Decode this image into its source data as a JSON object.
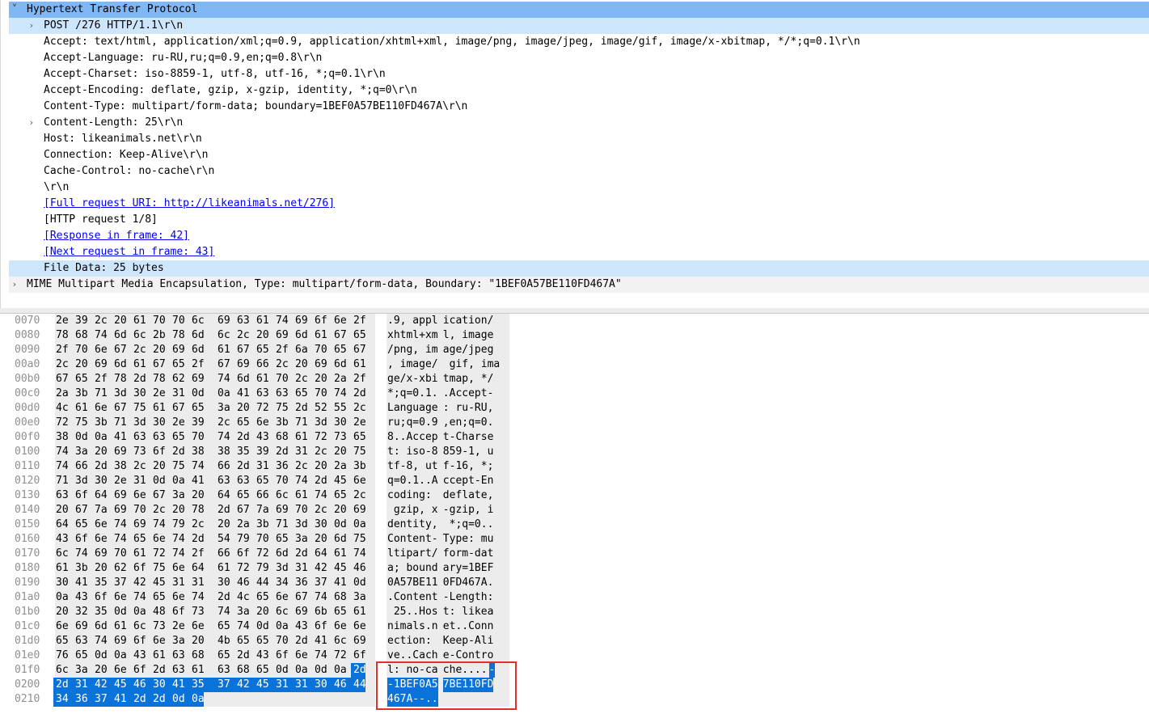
{
  "tree": {
    "rows": [
      {
        "level": 0,
        "toggle": "expanded",
        "text": "Hypertext Transfer Protocol",
        "style": "sel-dark",
        "link": false
      },
      {
        "level": 1,
        "toggle": "collapsed",
        "text": "POST /276 HTTP/1.1\\r\\n",
        "style": "sel-light",
        "link": false
      },
      {
        "level": 1,
        "toggle": "none",
        "text": "Accept: text/html, application/xml;q=0.9, application/xhtml+xml, image/png, image/jpeg, image/gif, image/x-xbitmap, */*;q=0.1\\r\\n",
        "style": "",
        "link": false
      },
      {
        "level": 1,
        "toggle": "none",
        "text": "Accept-Language: ru-RU,ru;q=0.9,en;q=0.8\\r\\n",
        "style": "",
        "link": false
      },
      {
        "level": 1,
        "toggle": "none",
        "text": "Accept-Charset: iso-8859-1, utf-8, utf-16, *;q=0.1\\r\\n",
        "style": "",
        "link": false
      },
      {
        "level": 1,
        "toggle": "none",
        "text": "Accept-Encoding: deflate, gzip, x-gzip, identity, *;q=0\\r\\n",
        "style": "",
        "link": false
      },
      {
        "level": 1,
        "toggle": "none",
        "text": "Content-Type: multipart/form-data; boundary=1BEF0A57BE110FD467A\\r\\n",
        "style": "",
        "link": false
      },
      {
        "level": 1,
        "toggle": "collapsed",
        "text": "Content-Length: 25\\r\\n",
        "style": "",
        "link": false
      },
      {
        "level": 1,
        "toggle": "none",
        "text": "Host: likeanimals.net\\r\\n",
        "style": "",
        "link": false
      },
      {
        "level": 1,
        "toggle": "none",
        "text": "Connection: Keep-Alive\\r\\n",
        "style": "",
        "link": false
      },
      {
        "level": 1,
        "toggle": "none",
        "text": "Cache-Control: no-cache\\r\\n",
        "style": "",
        "link": false
      },
      {
        "level": 1,
        "toggle": "none",
        "text": "\\r\\n",
        "style": "",
        "link": false
      },
      {
        "level": 1,
        "toggle": "none",
        "text": "[Full request URI: http://likeanimals.net/276]",
        "style": "",
        "link": true
      },
      {
        "level": 1,
        "toggle": "none",
        "text": "[HTTP request 1/8]",
        "style": "",
        "link": false
      },
      {
        "level": 1,
        "toggle": "none",
        "text": "[Response in frame: 42]",
        "style": "",
        "link": true
      },
      {
        "level": 1,
        "toggle": "none",
        "text": "[Next request in frame: 43]",
        "style": "",
        "link": true
      },
      {
        "level": 1,
        "toggle": "none",
        "text": "File Data: 25 bytes",
        "style": "sel-light",
        "link": false
      },
      {
        "level": 0,
        "toggle": "collapsed",
        "text": "MIME Multipart Media Encapsulation, Type: multipart/form-data, Boundary: \"1BEF0A57BE110FD467A\"",
        "style": "stripe",
        "link": false
      }
    ]
  },
  "hexdump": {
    "rows": [
      {
        "offset": "0070",
        "bytes": [
          "2e",
          "39",
          "2c",
          "20",
          "61",
          "70",
          "70",
          "6c",
          "69",
          "63",
          "61",
          "74",
          "69",
          "6f",
          "6e",
          "2f"
        ],
        "ascii": [
          ".9, appl",
          "ication/"
        ]
      },
      {
        "offset": "0080",
        "bytes": [
          "78",
          "68",
          "74",
          "6d",
          "6c",
          "2b",
          "78",
          "6d",
          "6c",
          "2c",
          "20",
          "69",
          "6d",
          "61",
          "67",
          "65"
        ],
        "ascii": [
          "xhtml+xm",
          "l, image"
        ]
      },
      {
        "offset": "0090",
        "bytes": [
          "2f",
          "70",
          "6e",
          "67",
          "2c",
          "20",
          "69",
          "6d",
          "61",
          "67",
          "65",
          "2f",
          "6a",
          "70",
          "65",
          "67"
        ],
        "ascii": [
          "/png, im",
          "age/jpeg"
        ]
      },
      {
        "offset": "00a0",
        "bytes": [
          "2c",
          "20",
          "69",
          "6d",
          "61",
          "67",
          "65",
          "2f",
          "67",
          "69",
          "66",
          "2c",
          "20",
          "69",
          "6d",
          "61"
        ],
        "ascii": [
          ", image/",
          " gif, ima"
        ]
      },
      {
        "offset": "00b0",
        "bytes": [
          "67",
          "65",
          "2f",
          "78",
          "2d",
          "78",
          "62",
          "69",
          "74",
          "6d",
          "61",
          "70",
          "2c",
          "20",
          "2a",
          "2f"
        ],
        "ascii": [
          "ge/x-xbi",
          "tmap, */"
        ]
      },
      {
        "offset": "00c0",
        "bytes": [
          "2a",
          "3b",
          "71",
          "3d",
          "30",
          "2e",
          "31",
          "0d",
          "0a",
          "41",
          "63",
          "63",
          "65",
          "70",
          "74",
          "2d"
        ],
        "ascii": [
          "*;q=0.1.",
          ".Accept-"
        ]
      },
      {
        "offset": "00d0",
        "bytes": [
          "4c",
          "61",
          "6e",
          "67",
          "75",
          "61",
          "67",
          "65",
          "3a",
          "20",
          "72",
          "75",
          "2d",
          "52",
          "55",
          "2c"
        ],
        "ascii": [
          "Language",
          ": ru-RU,"
        ]
      },
      {
        "offset": "00e0",
        "bytes": [
          "72",
          "75",
          "3b",
          "71",
          "3d",
          "30",
          "2e",
          "39",
          "2c",
          "65",
          "6e",
          "3b",
          "71",
          "3d",
          "30",
          "2e"
        ],
        "ascii": [
          "ru;q=0.9",
          ",en;q=0."
        ]
      },
      {
        "offset": "00f0",
        "bytes": [
          "38",
          "0d",
          "0a",
          "41",
          "63",
          "63",
          "65",
          "70",
          "74",
          "2d",
          "43",
          "68",
          "61",
          "72",
          "73",
          "65"
        ],
        "ascii": [
          "8..Accep",
          "t-Charse"
        ]
      },
      {
        "offset": "0100",
        "bytes": [
          "74",
          "3a",
          "20",
          "69",
          "73",
          "6f",
          "2d",
          "38",
          "38",
          "35",
          "39",
          "2d",
          "31",
          "2c",
          "20",
          "75"
        ],
        "ascii": [
          "t: iso-8",
          "859-1, u"
        ]
      },
      {
        "offset": "0110",
        "bytes": [
          "74",
          "66",
          "2d",
          "38",
          "2c",
          "20",
          "75",
          "74",
          "66",
          "2d",
          "31",
          "36",
          "2c",
          "20",
          "2a",
          "3b"
        ],
        "ascii": [
          "tf-8, ut",
          "f-16, *;"
        ]
      },
      {
        "offset": "0120",
        "bytes": [
          "71",
          "3d",
          "30",
          "2e",
          "31",
          "0d",
          "0a",
          "41",
          "63",
          "63",
          "65",
          "70",
          "74",
          "2d",
          "45",
          "6e"
        ],
        "ascii": [
          "q=0.1..A",
          "ccept-En"
        ]
      },
      {
        "offset": "0130",
        "bytes": [
          "63",
          "6f",
          "64",
          "69",
          "6e",
          "67",
          "3a",
          "20",
          "64",
          "65",
          "66",
          "6c",
          "61",
          "74",
          "65",
          "2c"
        ],
        "ascii": [
          "coding: ",
          "deflate,"
        ]
      },
      {
        "offset": "0140",
        "bytes": [
          "20",
          "67",
          "7a",
          "69",
          "70",
          "2c",
          "20",
          "78",
          "2d",
          "67",
          "7a",
          "69",
          "70",
          "2c",
          "20",
          "69"
        ],
        "ascii": [
          " gzip, x",
          "-gzip, i"
        ]
      },
      {
        "offset": "0150",
        "bytes": [
          "64",
          "65",
          "6e",
          "74",
          "69",
          "74",
          "79",
          "2c",
          "20",
          "2a",
          "3b",
          "71",
          "3d",
          "30",
          "0d",
          "0a"
        ],
        "ascii": [
          "dentity,",
          " *;q=0.."
        ]
      },
      {
        "offset": "0160",
        "bytes": [
          "43",
          "6f",
          "6e",
          "74",
          "65",
          "6e",
          "74",
          "2d",
          "54",
          "79",
          "70",
          "65",
          "3a",
          "20",
          "6d",
          "75"
        ],
        "ascii": [
          "Content-",
          "Type: mu"
        ]
      },
      {
        "offset": "0170",
        "bytes": [
          "6c",
          "74",
          "69",
          "70",
          "61",
          "72",
          "74",
          "2f",
          "66",
          "6f",
          "72",
          "6d",
          "2d",
          "64",
          "61",
          "74"
        ],
        "ascii": [
          "ltipart/",
          "form-dat"
        ]
      },
      {
        "offset": "0180",
        "bytes": [
          "61",
          "3b",
          "20",
          "62",
          "6f",
          "75",
          "6e",
          "64",
          "61",
          "72",
          "79",
          "3d",
          "31",
          "42",
          "45",
          "46"
        ],
        "ascii": [
          "a; bound",
          "ary=1BEF"
        ]
      },
      {
        "offset": "0190",
        "bytes": [
          "30",
          "41",
          "35",
          "37",
          "42",
          "45",
          "31",
          "31",
          "30",
          "46",
          "44",
          "34",
          "36",
          "37",
          "41",
          "0d"
        ],
        "ascii": [
          "0A57BE11",
          "0FD467A."
        ]
      },
      {
        "offset": "01a0",
        "bytes": [
          "0a",
          "43",
          "6f",
          "6e",
          "74",
          "65",
          "6e",
          "74",
          "2d",
          "4c",
          "65",
          "6e",
          "67",
          "74",
          "68",
          "3a"
        ],
        "ascii": [
          ".Content",
          "-Length:"
        ]
      },
      {
        "offset": "01b0",
        "bytes": [
          "20",
          "32",
          "35",
          "0d",
          "0a",
          "48",
          "6f",
          "73",
          "74",
          "3a",
          "20",
          "6c",
          "69",
          "6b",
          "65",
          "61"
        ],
        "ascii": [
          " 25..Hos",
          "t: likea"
        ]
      },
      {
        "offset": "01c0",
        "bytes": [
          "6e",
          "69",
          "6d",
          "61",
          "6c",
          "73",
          "2e",
          "6e",
          "65",
          "74",
          "0d",
          "0a",
          "43",
          "6f",
          "6e",
          "6e"
        ],
        "ascii": [
          "nimals.n",
          "et..Conn"
        ]
      },
      {
        "offset": "01d0",
        "bytes": [
          "65",
          "63",
          "74",
          "69",
          "6f",
          "6e",
          "3a",
          "20",
          "4b",
          "65",
          "65",
          "70",
          "2d",
          "41",
          "6c",
          "69"
        ],
        "ascii": [
          "ection: ",
          "Keep-Ali"
        ]
      },
      {
        "offset": "01e0",
        "bytes": [
          "76",
          "65",
          "0d",
          "0a",
          "43",
          "61",
          "63",
          "68",
          "65",
          "2d",
          "43",
          "6f",
          "6e",
          "74",
          "72",
          "6f"
        ],
        "ascii": [
          "ve..Cach",
          "e-Contro"
        ]
      },
      {
        "offset": "01f0",
        "bytes": [
          "6c",
          "3a",
          "20",
          "6e",
          "6f",
          "2d",
          "63",
          "61",
          "63",
          "68",
          "65",
          "0d",
          "0a",
          "0d",
          "0a",
          "2d"
        ],
        "ascii": [
          "l: no-ca",
          "che....-"
        ]
      },
      {
        "offset": "0200",
        "bytes": [
          "2d",
          "31",
          "42",
          "45",
          "46",
          "30",
          "41",
          "35",
          "37",
          "42",
          "45",
          "31",
          "31",
          "30",
          "46",
          "44"
        ],
        "ascii": [
          "-1BEF0A5",
          "7BE110FD"
        ]
      },
      {
        "offset": "0210",
        "bytes": [
          "34",
          "36",
          "37",
          "41",
          "2d",
          "2d",
          "0d",
          "0a"
        ],
        "ascii": [
          "467A--..",
          ""
        ]
      }
    ],
    "selection": {
      "start_offset": "01ff",
      "length": 25
    }
  }
}
